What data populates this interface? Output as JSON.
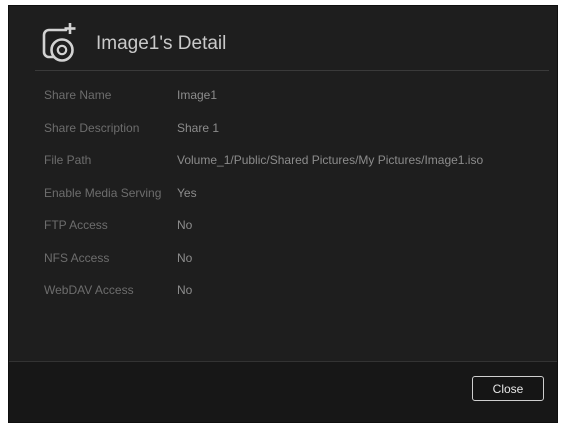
{
  "dialog": {
    "title": "Image1's Detail",
    "icon": "disc-image-add-icon"
  },
  "details": [
    {
      "label": "Share Name",
      "value": "Image1"
    },
    {
      "label": "Share Description",
      "value": "Share 1"
    },
    {
      "label": "File Path",
      "value": "Volume_1/Public/Shared Pictures/My Pictures/Image1.iso"
    },
    {
      "label": "Enable Media Serving",
      "value": "Yes"
    },
    {
      "label": "FTP Access",
      "value": "No"
    },
    {
      "label": "NFS Access",
      "value": "No"
    },
    {
      "label": "WebDAV Access",
      "value": "No"
    }
  ],
  "footer": {
    "close_label": "Close"
  },
  "colors": {
    "background": "#1e1e1e",
    "label": "#6d6d6d",
    "value": "#8c8c8c",
    "title": "#c9c9c9"
  }
}
